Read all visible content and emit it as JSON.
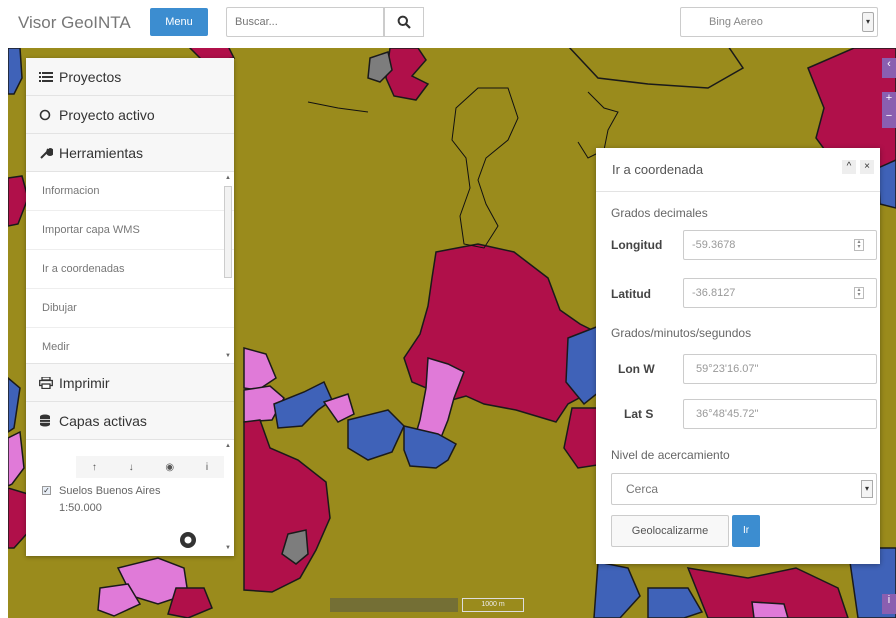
{
  "app": {
    "title": "Visor GeoINTA"
  },
  "toolbar": {
    "menu_label": "Menu",
    "search_placeholder": "Buscar...",
    "basemap_value": "Bing Aereo"
  },
  "sidebar": {
    "proyectos": "Proyectos",
    "proyecto_activo": "Proyecto activo",
    "herramientas": "Herramientas",
    "tools": [
      "Informacion",
      "Importar capa WMS",
      "Ir a coordenadas",
      "Dibujar",
      "Medir"
    ],
    "imprimir": "Imprimir",
    "capas_activas": "Capas activas",
    "layer_name": "Suelos Buenos Aires",
    "layer_scale": "1:50.000",
    "layer_checked": true
  },
  "coord_panel": {
    "title": "Ir a coordenada",
    "decimal_section": "Grados decimales",
    "longitud_label": "Longitud",
    "longitud_value": "-59.3678",
    "latitud_label": "Latitud",
    "latitud_value": "-36.8127",
    "dms_section": "Grados/minutos/segundos",
    "lon_label": "Lon W",
    "lon_value": "59°23'16.07\"",
    "lat_label": "Lat S",
    "lat_value": "36°48'45.72\"",
    "zoom_section": "Nivel de acercamiento",
    "zoom_value": "Cerca",
    "geolocate_label": "Geolocalizarme",
    "go_label": "Ir"
  },
  "map": {
    "scale_label": "1000 m",
    "colors": {
      "background": "#9a8b1c",
      "crimson": "#b0104a",
      "blue": "#3f62b8",
      "pink": "#e07ad8",
      "gray": "#7d7d7d",
      "accent": "#3c8dd0"
    }
  }
}
